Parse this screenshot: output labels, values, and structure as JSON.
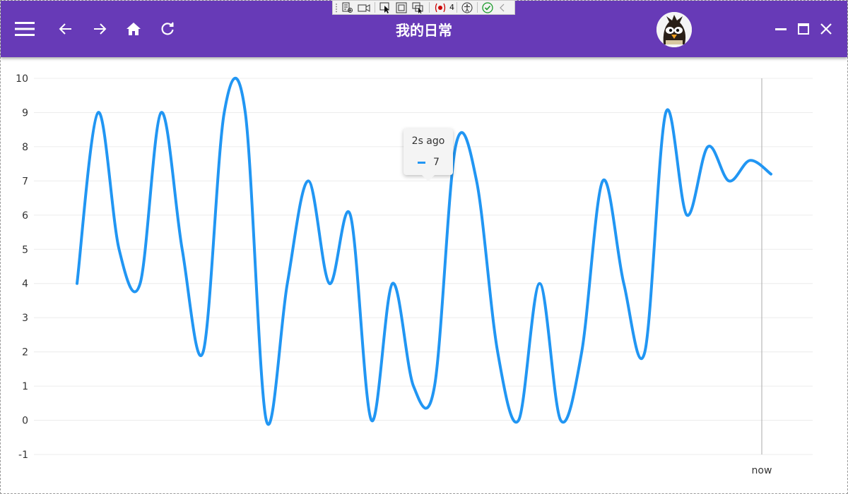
{
  "window": {
    "title": "我的日常",
    "colors": {
      "accent": "#673ab7",
      "series": "#2196f3"
    }
  },
  "toolbar": {
    "menu_icon": "hamburger-menu-icon",
    "back_icon": "arrow-left-icon",
    "forward_icon": "arrow-right-icon",
    "home_icon": "home-icon",
    "refresh_icon": "refresh-icon",
    "avatar": "user-avatar",
    "minimize_icon": "minimize-icon",
    "maximize_icon": "maximize-icon",
    "close_icon": "close-icon"
  },
  "devtools": {
    "binding_failures": "4",
    "icons": [
      "live-visual-tree-icon",
      "record-icon",
      "select-element-icon",
      "display-layout-adorners-icon",
      "track-focus-icon",
      "binding-failures-icon",
      "accessibility-icon",
      "check-icon",
      "collapse-icon"
    ]
  },
  "tooltip": {
    "label": "2s ago",
    "value": "7"
  },
  "chart_data": {
    "type": "line",
    "y_ticks": [
      "10",
      "9",
      "8",
      "7",
      "6",
      "5",
      "4",
      "3",
      "2",
      "1",
      "0",
      "-1"
    ],
    "x_ticks": [
      "now"
    ],
    "ylim": [
      -1,
      10
    ],
    "grid": true,
    "smooth": true,
    "series": [
      {
        "values": [
          4,
          9,
          5,
          4,
          9,
          5,
          2,
          9,
          9,
          0,
          4,
          7,
          4,
          6,
          0,
          4,
          1,
          1,
          8,
          7,
          2,
          0,
          4,
          0,
          2,
          7,
          4,
          2,
          9,
          6,
          8,
          7,
          7.6,
          7.2
        ]
      }
    ]
  }
}
